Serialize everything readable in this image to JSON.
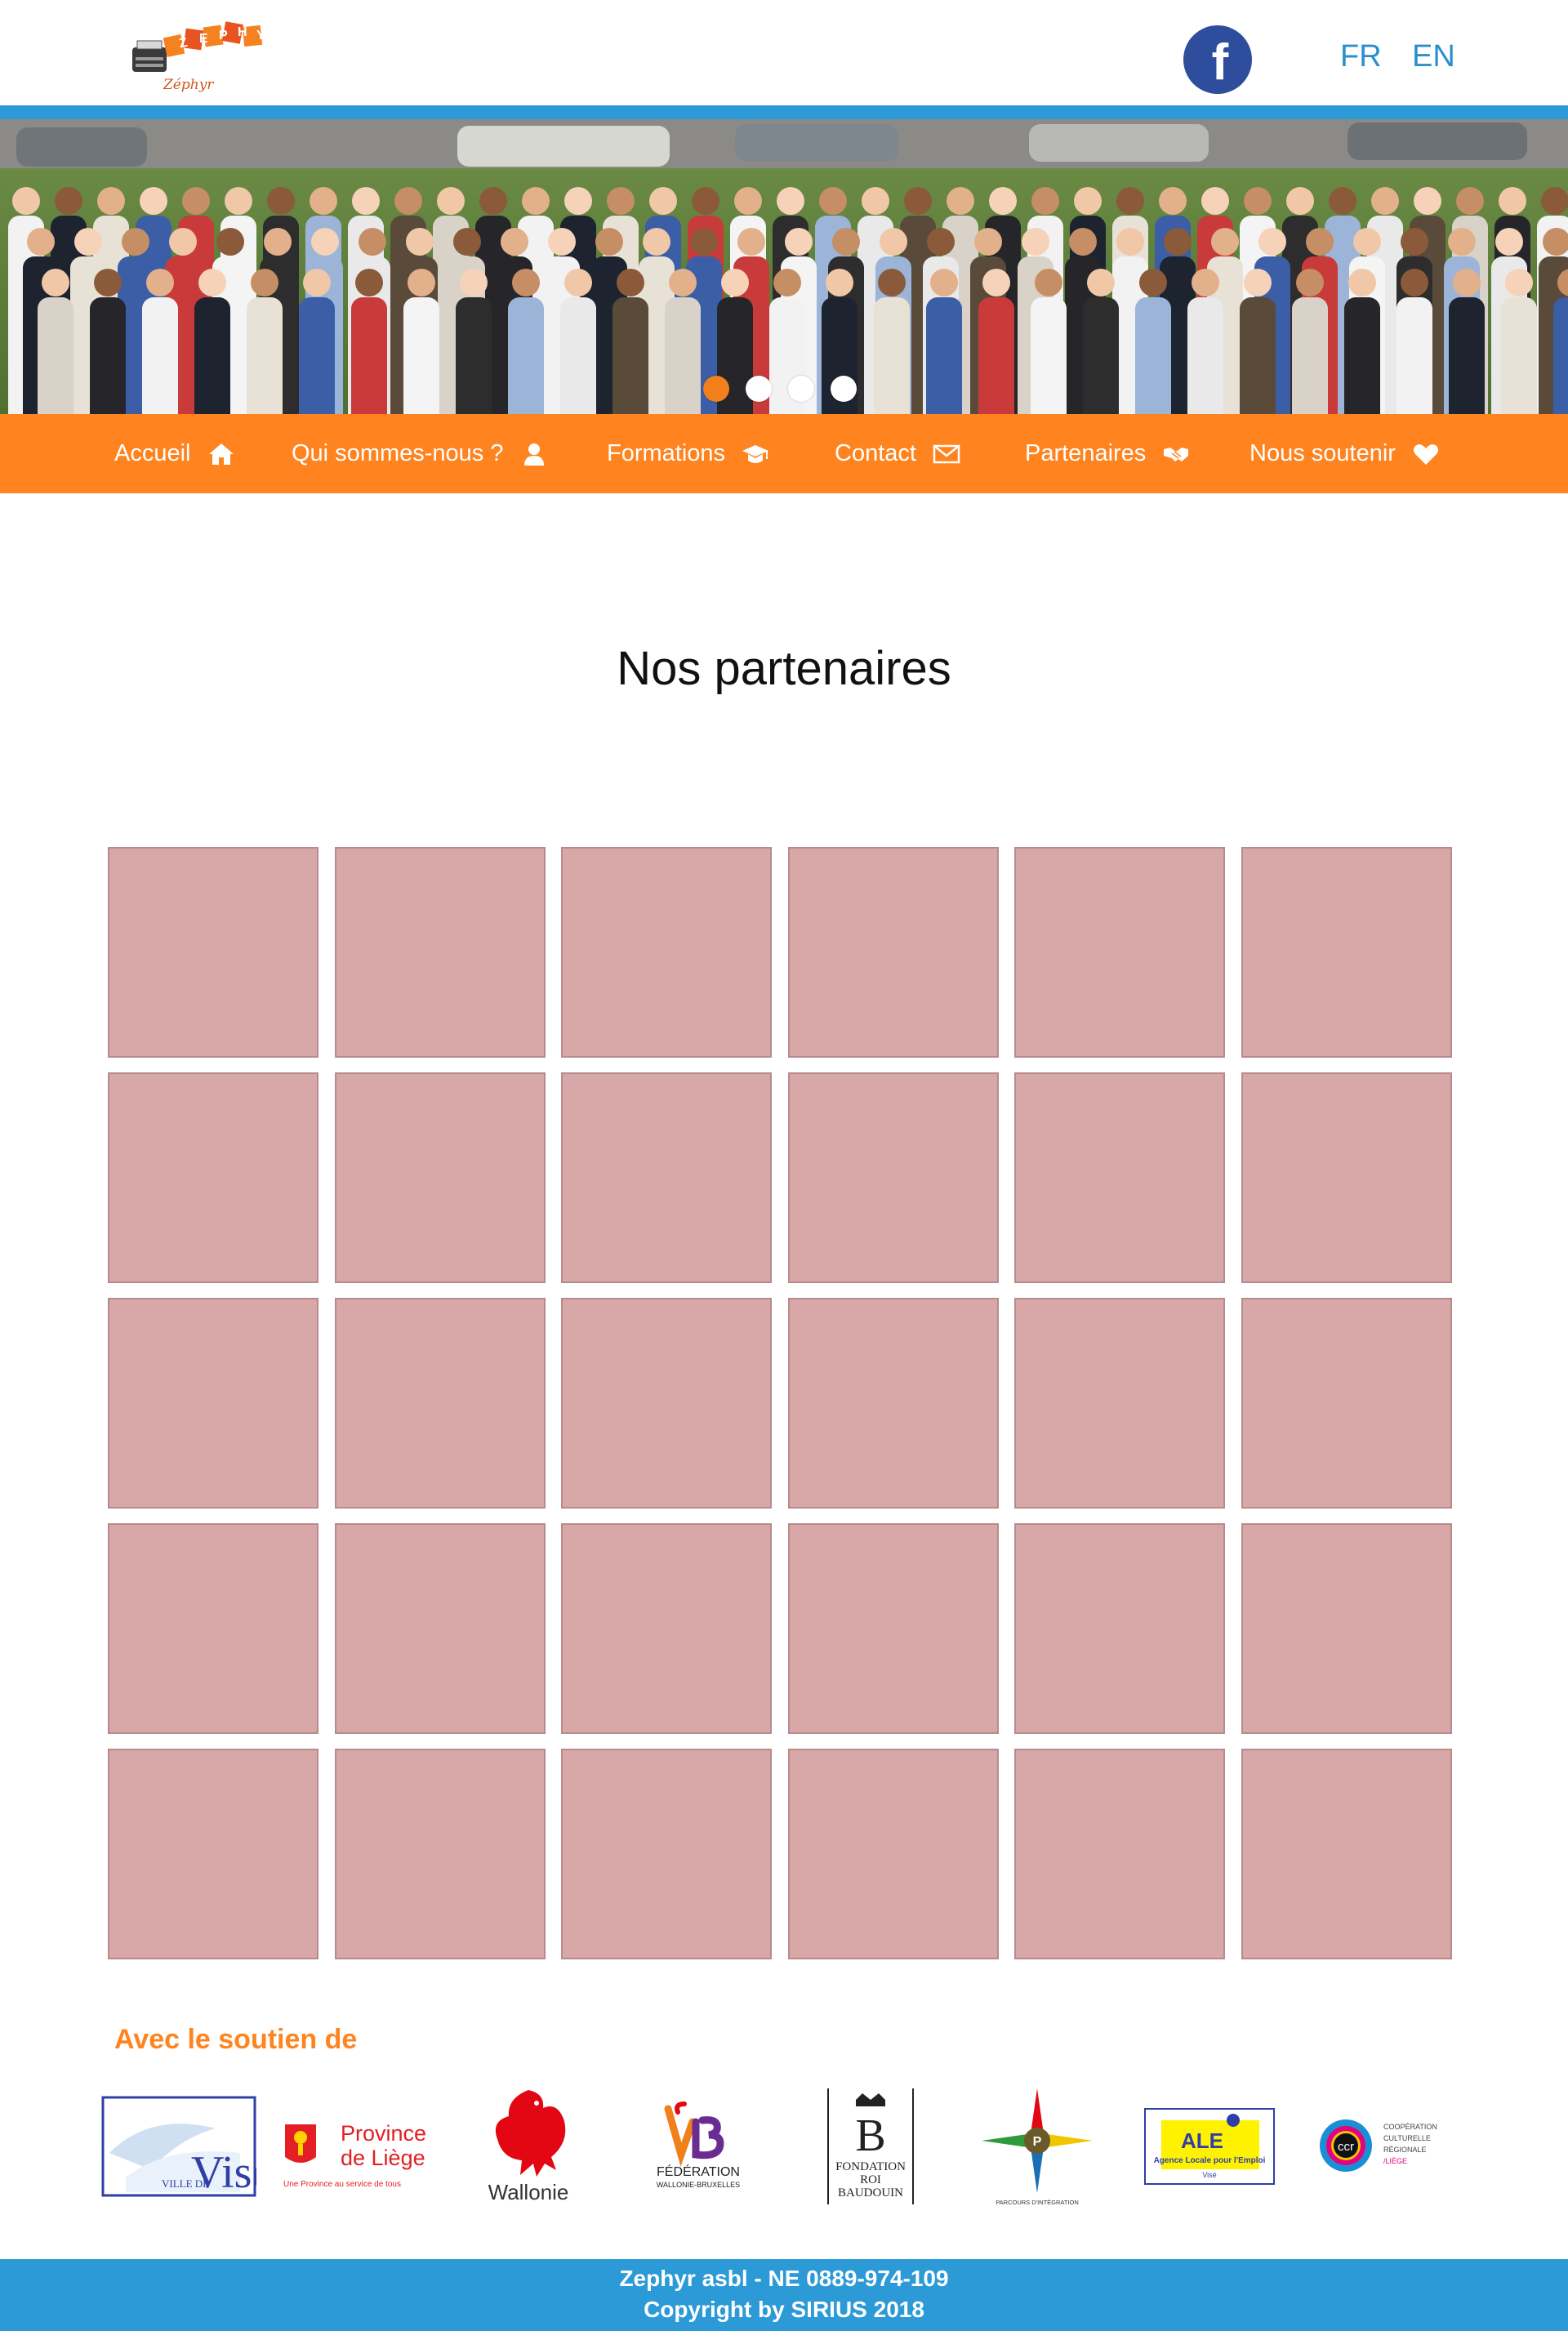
{
  "header": {
    "logo_text": "Zéphyr",
    "social_icon": "facebook-icon",
    "lang_fr": "FR",
    "lang_en": "EN"
  },
  "hero": {
    "slide_count": 4,
    "active_slide": 1
  },
  "nav": {
    "items": [
      {
        "label": "Accueil",
        "icon": "home-icon"
      },
      {
        "label": "Qui sommes-nous ?",
        "icon": "user-icon"
      },
      {
        "label": "Formations",
        "icon": "graduation-cap-icon"
      },
      {
        "label": "Contact",
        "icon": "envelope-icon"
      },
      {
        "label": "Partenaires",
        "icon": "handshake-icon"
      },
      {
        "label": "Nous soutenir",
        "icon": "heart-icon"
      }
    ]
  },
  "main": {
    "title": "Nos partenaires",
    "partner_tiles": 30
  },
  "support": {
    "title": "Avec le soutien de",
    "sponsors": [
      {
        "name": "Visé",
        "caption": "VILLE DE"
      },
      {
        "name": "Province de Liège",
        "line1": "Province",
        "line2": "de Liège",
        "tagline": "Une Province au service de tous"
      },
      {
        "name": "Wallonie",
        "caption": "Wallonie"
      },
      {
        "name": "Fédération Wallonie-Bruxelles",
        "line1": "FÉDÉRATION",
        "line2": "WALLONIE-BRUXELLES"
      },
      {
        "name": "Fondation Roi Baudouin",
        "line1": "FONDATION",
        "line2": "ROI",
        "line3": "BAUDOUIN"
      },
      {
        "name": "Parcours d'intégration",
        "caption": "PARCOURS D'INTÉGRATION"
      },
      {
        "name": "ALE",
        "line1": "ALE",
        "line2": "Agence Locale pour l'Emploi",
        "line3": "Visé"
      },
      {
        "name": "CCR",
        "line1": "COOPÉRATION",
        "line2": "CULTURELLE",
        "line3": "RÉGIONALE",
        "line4": "/LIÈGE",
        "badge": "ccr"
      }
    ]
  },
  "footer": {
    "line1": "Zephyr asbl - NE 0889-974-109",
    "line2": "Copyright by SIRIUS 2018"
  },
  "colors": {
    "orange": "#ff841f",
    "blue": "#2b9ad6",
    "tile": "#d8a7a8"
  }
}
